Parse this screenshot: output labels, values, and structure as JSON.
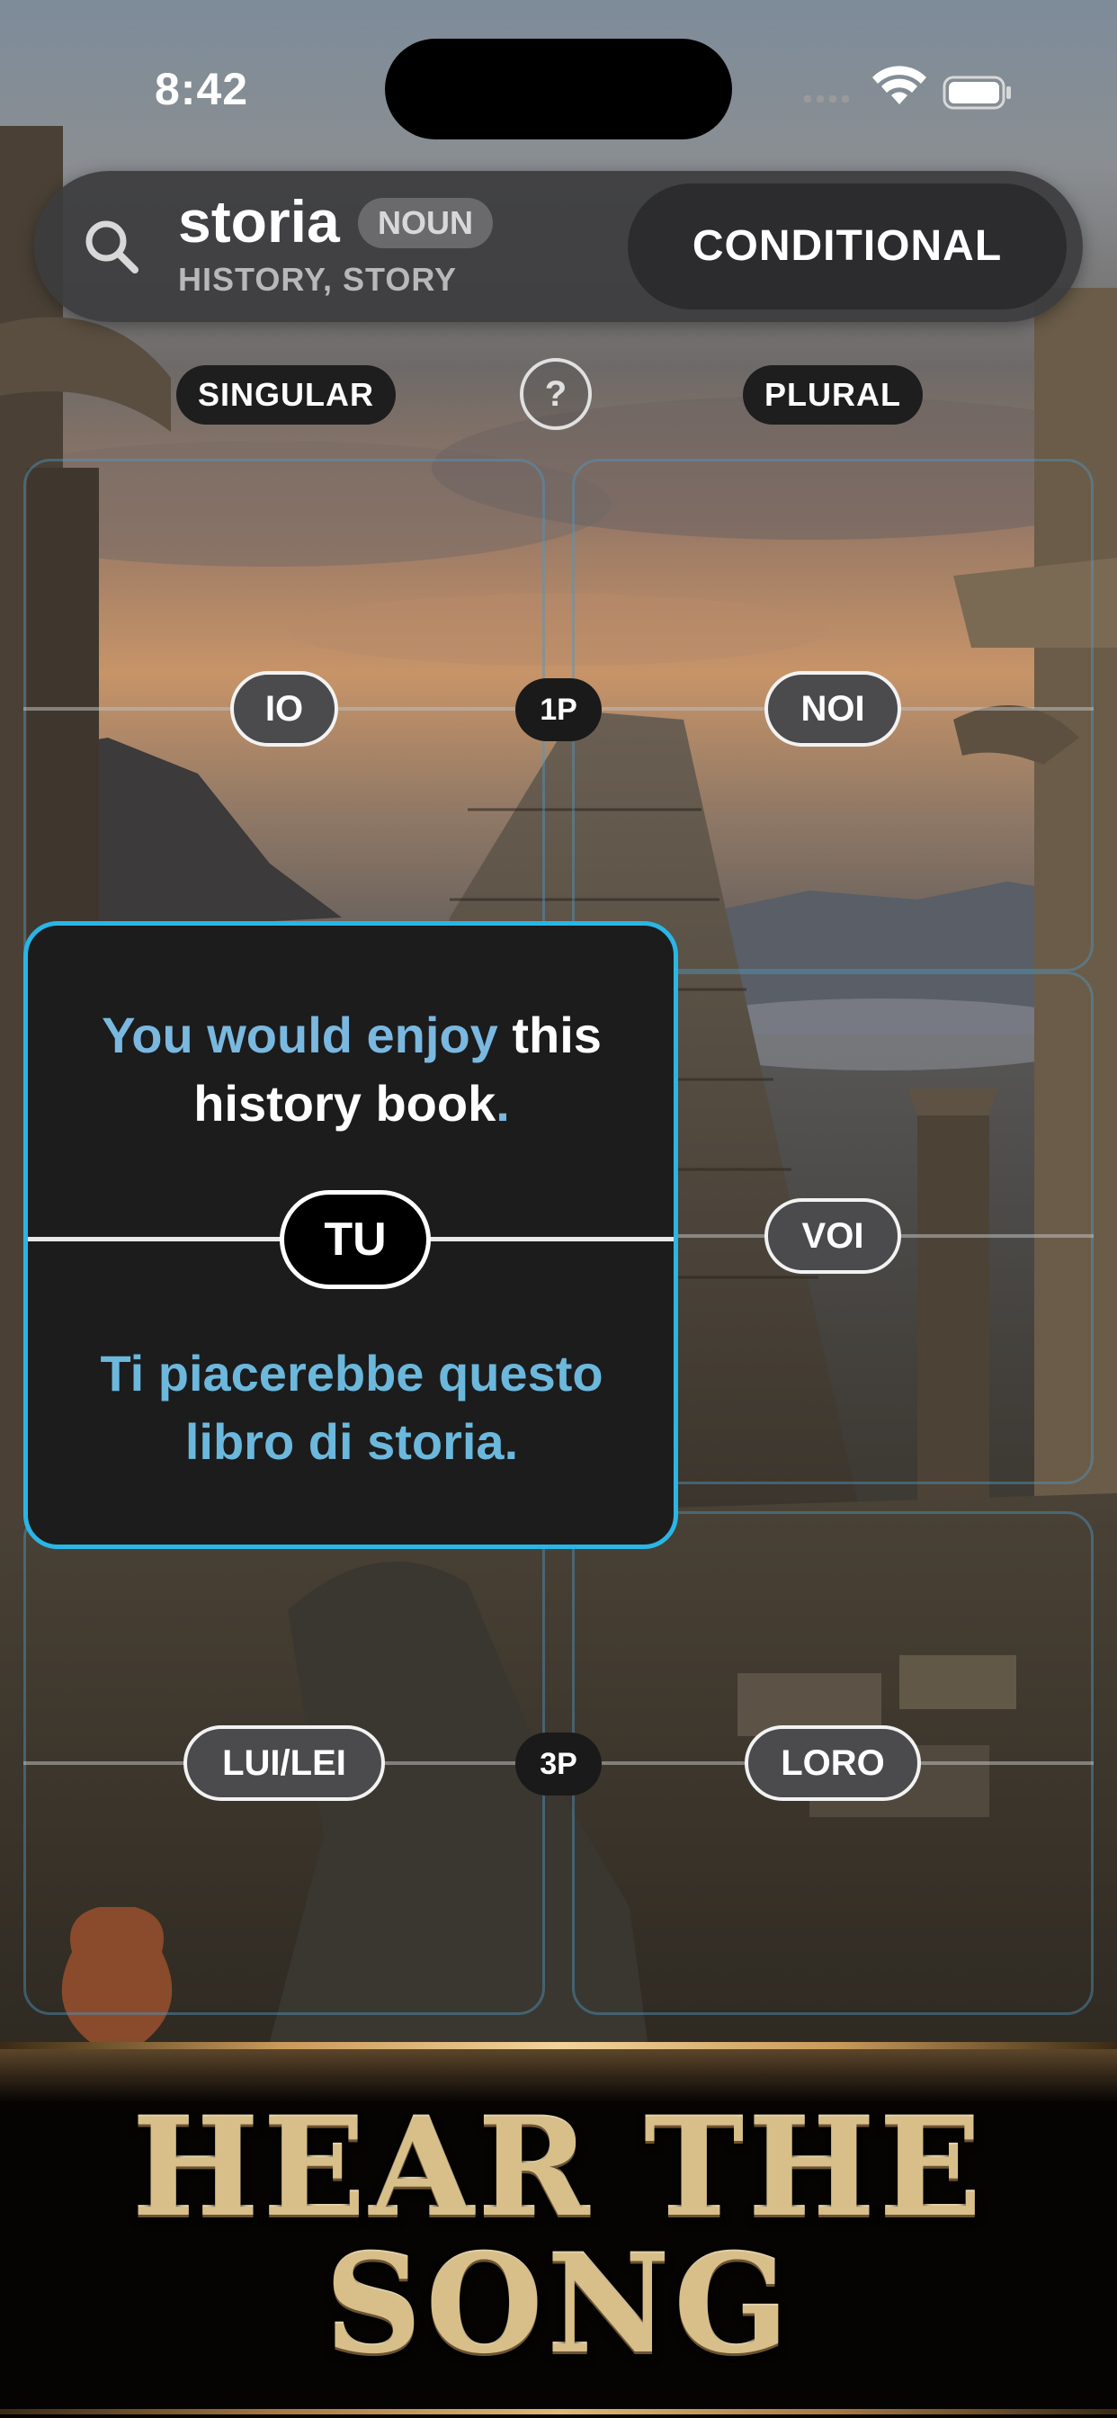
{
  "status_bar": {
    "time": "8:42"
  },
  "search": {
    "word": "storia",
    "part_of_speech": "NOUN",
    "meaning": "HISTORY, STORY",
    "tense": "CONDITIONAL"
  },
  "columns": {
    "singular": "SINGULAR",
    "help": "?",
    "plural": "PLURAL"
  },
  "rows": {
    "first_person": {
      "marker": "1P",
      "singular": "IO",
      "plural": "NOI"
    },
    "second_person": {
      "singular": "TU",
      "plural": "VOI"
    },
    "third_person": {
      "marker": "3P",
      "singular": "LUI/LEI",
      "plural": "LORO"
    }
  },
  "card": {
    "english": {
      "a": "You would enjoy",
      "b": " this ",
      "c": "history",
      "d": " book",
      "e": "."
    },
    "italian": "Ti piacerebbe questo libro di storia."
  },
  "banner": {
    "line1": "HEAR THE",
    "line2": "SONG"
  },
  "colors": {
    "accent": "#29b6e6",
    "italian_text": "#6bb8dc",
    "gold": "#d8bf8a"
  }
}
